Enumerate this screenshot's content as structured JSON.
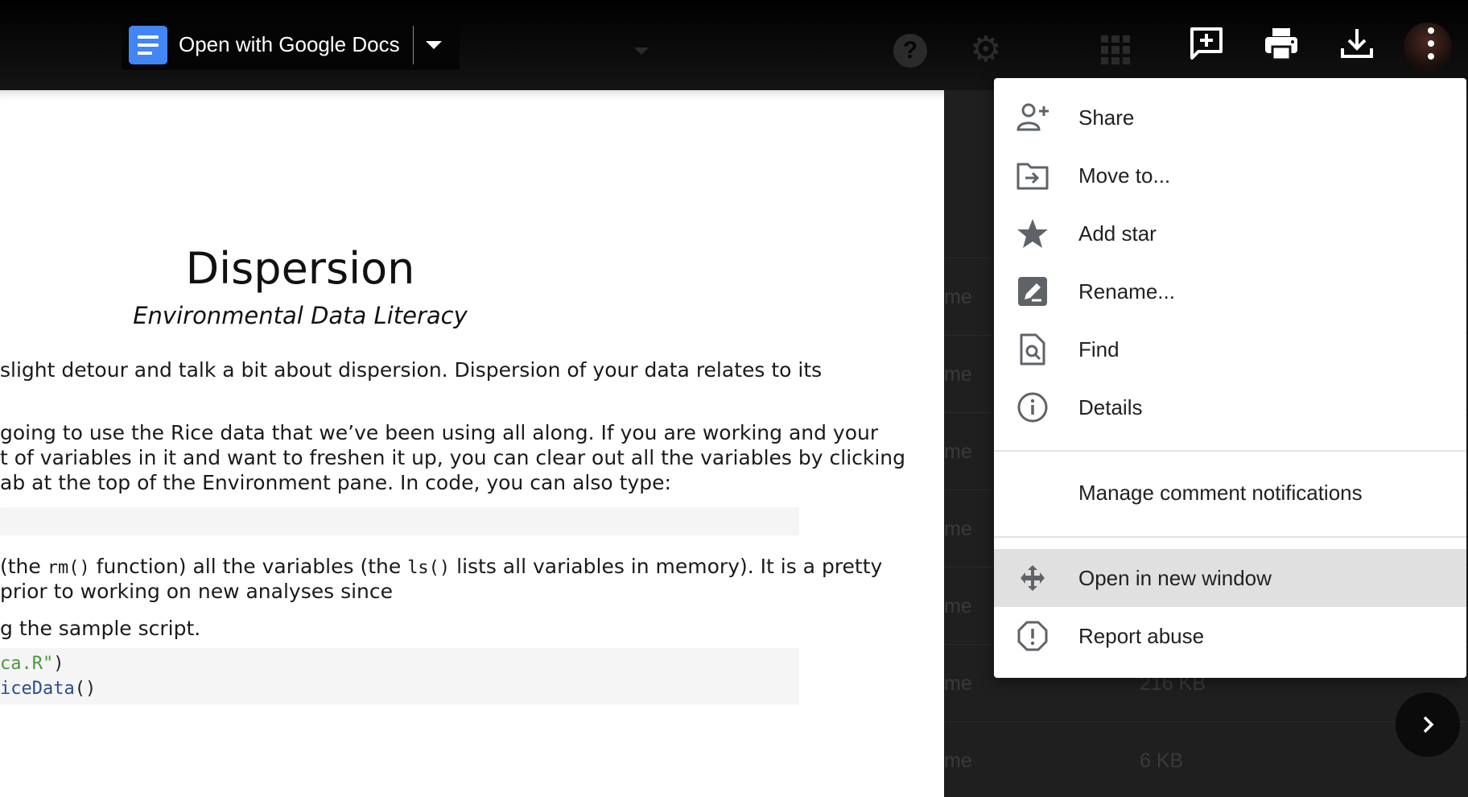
{
  "toolbar": {
    "open_with_label": "Open with Google Docs",
    "icons": [
      "docs-icon",
      "dropdown-arrow-icon",
      "help-icon",
      "gear-icon",
      "apps-grid-icon",
      "add-comment-icon",
      "print-icon",
      "download-icon",
      "avatar",
      "more-vert-icon"
    ]
  },
  "document": {
    "title": "Dispersion",
    "subtitle": "Environmental Data Literacy",
    "para1": "slight detour and talk a bit about dispersion. Dispersion of your data relates to its",
    "para2_lines": [
      "going to use the Rice data that we’ve been using all along. If you are working and your",
      "t of variables in it and want to freshen it up, you can clear out all the variables by clicking",
      "ab at the top of the Environment pane. In code, you can also type:"
    ],
    "para3_a": "(the ",
    "para3_rm": "rm()",
    "para3_b": " function) all the variables (the ",
    "para3_ls": "ls()",
    "para3_c": " lists all variables in memory). It is a pretty",
    "para3_line2": "prior to working on new analyses since",
    "para4": "g the sample script.",
    "code_line1_str": "ca.R\"",
    "code_line1_end": ")",
    "code_line2_fn": "iceData",
    "code_line2_end": "()"
  },
  "file_list": {
    "name_fragments": [
      "me",
      "me",
      "me",
      "me",
      "me",
      "me",
      "me"
    ],
    "sizes": [
      "216 KB",
      "6 KB"
    ]
  },
  "menu": {
    "items": [
      {
        "label": "Share",
        "icon": "person-add-icon"
      },
      {
        "label": "Move to...",
        "icon": "move-to-folder-icon"
      },
      {
        "label": "Add star",
        "icon": "star-icon"
      },
      {
        "label": "Rename...",
        "icon": "rename-icon"
      },
      {
        "label": "Find",
        "icon": "find-in-page-icon"
      },
      {
        "label": "Details",
        "icon": "info-icon"
      },
      {
        "label": "Manage comment notifications",
        "icon": ""
      },
      {
        "label": "Open in new window",
        "icon": "open-with-icon",
        "highlighted": true
      },
      {
        "label": "Report abuse",
        "icon": "report-icon"
      }
    ]
  },
  "colors": {
    "docs_blue": "#4285f4",
    "menu_highlight": "#e0e0e0",
    "code_string": "#4a9a3a",
    "code_function": "#2a4f8a"
  }
}
